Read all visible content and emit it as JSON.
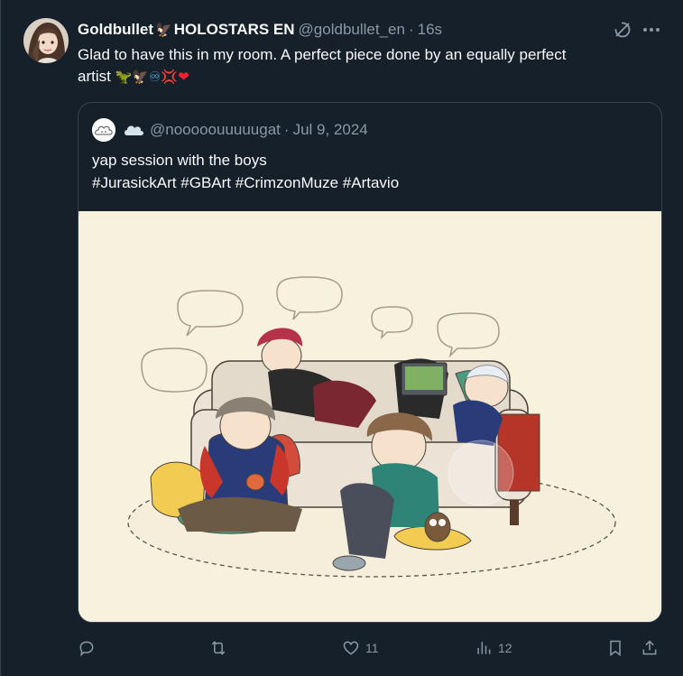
{
  "tweet": {
    "display_name": "Goldbullet",
    "name_suffix": "HOLOSTARS EN",
    "name_emoji": "🦅",
    "handle": "@goldbullet_en",
    "separator": "·",
    "time": "16s",
    "text_line1": "Glad to have this in my room. A perfect piece done by an equally perfect",
    "text_line2": "artist",
    "emojis": [
      "🦖",
      "🦅",
      "♾",
      "💢",
      "❤"
    ],
    "avatar_icon": "user-avatar"
  },
  "quote": {
    "cloud_emoji": "☁",
    "handle": "@nooooouuuuugat",
    "separator": "·",
    "date": "Jul 9, 2024",
    "text_line1": "yap session with the boys",
    "hashtags": [
      "#JurasickArt",
      "#GBArt",
      "#CrimzonMuze",
      "#Artavio"
    ],
    "image_icon": "illustration-image"
  },
  "actions": {
    "reply_count": "",
    "retweet_count": "",
    "like_count": "11",
    "views_count": "12"
  },
  "colors": {
    "background": "#15202b",
    "border": "#38444d",
    "text_primary": "#f7f9f9",
    "text_secondary": "#8b98a5",
    "image_bg": "#f8f1dd"
  }
}
